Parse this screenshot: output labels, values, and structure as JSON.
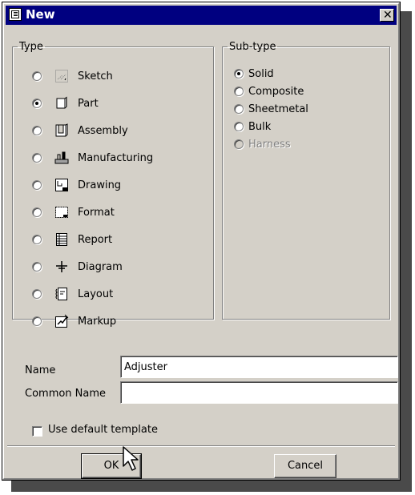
{
  "window": {
    "title": "New",
    "close_glyph": "✕",
    "title_icon": "new-document-icon"
  },
  "type_group": {
    "legend": "Type",
    "selected": "Part",
    "items": [
      {
        "label": "Sketch",
        "icon": "sketch-icon",
        "checked": false
      },
      {
        "label": "Part",
        "icon": "part-icon",
        "checked": true
      },
      {
        "label": "Assembly",
        "icon": "assembly-icon",
        "checked": false
      },
      {
        "label": "Manufacturing",
        "icon": "manufacturing-icon",
        "checked": false
      },
      {
        "label": "Drawing",
        "icon": "drawing-icon",
        "checked": false
      },
      {
        "label": "Format",
        "icon": "format-icon",
        "checked": false
      },
      {
        "label": "Report",
        "icon": "report-icon",
        "checked": false
      },
      {
        "label": "Diagram",
        "icon": "diagram-icon",
        "checked": false
      },
      {
        "label": "Layout",
        "icon": "layout-icon",
        "checked": false
      },
      {
        "label": "Markup",
        "icon": "markup-icon",
        "checked": false
      }
    ]
  },
  "subtype_group": {
    "legend": "Sub-type",
    "selected": "Solid",
    "items": [
      {
        "label": "Solid",
        "checked": true,
        "enabled": true
      },
      {
        "label": "Composite",
        "checked": false,
        "enabled": true
      },
      {
        "label": "Sheetmetal",
        "checked": false,
        "enabled": true
      },
      {
        "label": "Bulk",
        "checked": false,
        "enabled": true
      },
      {
        "label": "Harness",
        "checked": false,
        "enabled": false
      }
    ]
  },
  "form": {
    "name_label": "Name",
    "name_value": "Adjuster",
    "common_name_label": "Common Name",
    "common_name_value": "",
    "default_template_label": "Use default template",
    "default_template_checked": false
  },
  "buttons": {
    "ok": "OK",
    "cancel": "Cancel"
  },
  "colors": {
    "titlebar": "#000080",
    "dialog_face": "#d4d0c8",
    "disabled_text": "#808080"
  }
}
